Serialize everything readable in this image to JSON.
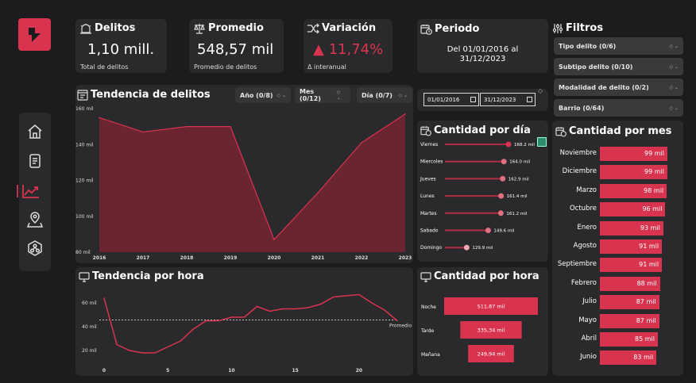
{
  "nav": {
    "items": [
      "home",
      "document",
      "trend",
      "map",
      "network"
    ],
    "active": 2
  },
  "kpis": {
    "delitos": {
      "title": "Delitos",
      "value": "1,10 mill.",
      "sub": "Total de delitos"
    },
    "promedio": {
      "title": "Promedio",
      "value": "548,57 mil",
      "sub": "Promedio de delitos"
    },
    "variacion": {
      "title": "Variación",
      "value": "11,74%",
      "arrow": "▲",
      "sub": "Δ interanual",
      "color": "#d9344f"
    }
  },
  "periodo": {
    "title": "Periodo",
    "line1": "Del 01/01/2016 al",
    "line2": "31/12/2023"
  },
  "filtros": {
    "title": "Filtros",
    "items": [
      "Tipo delito (0/6)",
      "Subtipo delito (0/10)",
      "Modalidad de delito (0/2)",
      "Barrio (0/64)"
    ]
  },
  "date_range": {
    "from": "01/01/2016",
    "to": "31/12/2023"
  },
  "tendencia_delitos": {
    "title": "Tendencia de delitos",
    "slicers": [
      "Año (0/8)",
      "Mes (0/12)",
      "Día (0/7)"
    ],
    "chart_data": {
      "type": "area",
      "x": [
        2016,
        2017,
        2018,
        2019,
        2020,
        2021,
        2022,
        2023
      ],
      "y": [
        155,
        147,
        150,
        150,
        87,
        113,
        141,
        157
      ],
      "ylim": [
        80,
        160
      ],
      "yticks": [
        "80 mil",
        "100 mil",
        "120 mil",
        "140 mil",
        "160 mil"
      ],
      "color": "#d9344f"
    }
  },
  "tendencia_hora": {
    "title": "Tendencia por hora",
    "chart_data": {
      "type": "line",
      "x": [
        0,
        1,
        2,
        3,
        4,
        5,
        6,
        7,
        8,
        9,
        10,
        11,
        12,
        13,
        14,
        15,
        16,
        17,
        18,
        19,
        20,
        21,
        22,
        23
      ],
      "y": [
        64,
        25,
        20,
        18,
        18,
        23,
        28,
        38,
        45,
        45,
        48,
        48,
        57,
        53,
        55,
        55,
        56,
        59,
        65,
        66,
        67,
        60,
        54,
        45
      ],
      "ylim": [
        10,
        70
      ],
      "yticks": [
        "20 mil",
        "40 mil",
        "60 mil"
      ],
      "xticks": [
        "0",
        "5",
        "10",
        "15",
        "20"
      ],
      "reference": {
        "label": "Promedio",
        "value": 45.7
      },
      "color": "#d9344f"
    }
  },
  "cantidad_dia": {
    "title": "Cantidad por día",
    "chart_data": {
      "type": "bar",
      "categories": [
        "Viernes",
        "Miercoles",
        "Jueves",
        "Lunes",
        "Martes",
        "Sabado",
        "Domingo"
      ],
      "values": [
        168.2,
        164.0,
        162.9,
        161.4,
        161.2,
        149.6,
        129.9
      ],
      "labels": [
        "168.2 mil",
        "164.0 mil",
        "162.9 mil",
        "161.4 mil",
        "161.2 mil",
        "149.6 mil",
        "129.9 mil"
      ],
      "xlim": [
        0,
        168.2
      ]
    }
  },
  "cantidad_hora_funnel": {
    "title": "Cantidad por hora",
    "chart_data": {
      "type": "bar",
      "categories": [
        "Noche",
        "Tarde",
        "Mañana"
      ],
      "values": [
        511.87,
        335.34,
        249.94
      ],
      "labels": [
        "511,87 mil",
        "335,34 mil",
        "249,94 mil"
      ]
    }
  },
  "cantidad_mes": {
    "title": "Cantidad por mes",
    "chart_data": {
      "type": "bar",
      "categories": [
        "Noviembre",
        "Diciembre",
        "Marzo",
        "Octubre",
        "Enero",
        "Agosto",
        "Septiembre",
        "Febrero",
        "Julio",
        "Mayo",
        "Abril",
        "Junio"
      ],
      "values": [
        99,
        99,
        98,
        96,
        93,
        91,
        91,
        88,
        87,
        87,
        85,
        83
      ],
      "labels": [
        "99 mil",
        "99 mil",
        "98 mil",
        "96 mil",
        "93 mil",
        "91 mil",
        "91 mil",
        "88 mil",
        "87 mil",
        "87 mil",
        "85 mil",
        "83 mil"
      ]
    }
  }
}
